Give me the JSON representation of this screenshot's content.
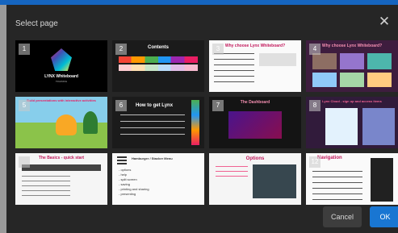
{
  "dialog": {
    "title": "Select page",
    "cancel_label": "Cancel",
    "ok_label": "OK"
  },
  "pages": [
    {
      "number": "1",
      "title": "LYNX Whiteboard",
      "sub": "TRAINING"
    },
    {
      "number": "2",
      "title": "Contents"
    },
    {
      "number": "3",
      "title": "Why choose Lynx Whiteboard?"
    },
    {
      "number": "4",
      "title": "Why choose Lynx Whiteboard?"
    },
    {
      "number": "5",
      "title": "Build presentations with interactive activities"
    },
    {
      "number": "6",
      "title": "How to get Lynx"
    },
    {
      "number": "7",
      "title": "The Dashboard"
    },
    {
      "number": "8",
      "title": "Lynx Cloud - sign up and access items"
    },
    {
      "number": "",
      "title": "The Basics - quick start"
    },
    {
      "number": "",
      "title": "Hamburger / Stacker Menu",
      "items": [
        "- options",
        "- help",
        "- split screen",
        "- saving",
        "- printing and sharing",
        "- presenting"
      ]
    },
    {
      "number": "",
      "title": "Options"
    },
    {
      "number": "12",
      "title": "Navigation"
    }
  ],
  "colors": {
    "accent": "#1976d2",
    "dialog_bg": "#262626"
  }
}
